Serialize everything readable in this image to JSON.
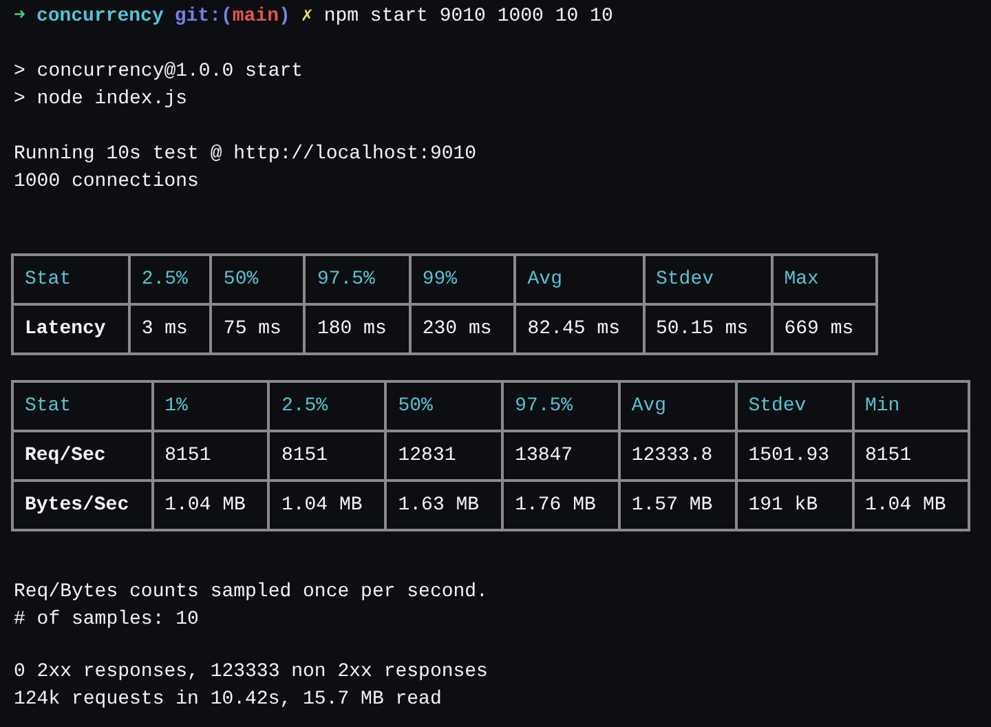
{
  "prompt": {
    "arrow": "➜",
    "directory": "concurrency",
    "git_prefix": "git:(",
    "branch": "main",
    "git_suffix": ")",
    "dirty_mark": "✗",
    "command": "npm start 9010 1000 10 10"
  },
  "blocks_before": [
    [
      "> concurrency@1.0.0 start",
      "> node index.js"
    ],
    [
      "Running 10s test @ http://localhost:9010",
      "1000 connections"
    ]
  ],
  "tables": [
    {
      "columns": [
        "Stat",
        "2.5%",
        "50%",
        "97.5%",
        "99%",
        "Avg",
        "Stdev",
        "Max"
      ],
      "rows": [
        {
          "cells": [
            "Latency",
            "3 ms",
            "75 ms",
            "180 ms",
            "230 ms",
            "82.45 ms",
            "50.15 ms",
            "669 ms"
          ]
        }
      ]
    },
    {
      "columns": [
        "Stat",
        "1%",
        "2.5%",
        "50%",
        "97.5%",
        "Avg",
        "Stdev",
        "Min"
      ],
      "rows": [
        {
          "cells": [
            "Req/Sec",
            "8151",
            "8151",
            "12831",
            "13847",
            "12333.8",
            "1501.93",
            "8151"
          ]
        },
        {
          "cells": [
            "Bytes/Sec",
            "1.04 MB",
            "1.04 MB",
            "1.63 MB",
            "1.76 MB",
            "1.57 MB",
            "191 kB",
            "1.04 MB"
          ]
        }
      ]
    }
  ],
  "blocks_after": [
    [
      "Req/Bytes counts sampled once per second.",
      "# of samples: 10"
    ],
    [
      "0 2xx responses, 123333 non 2xx responses",
      "124k requests in 10.42s, 15.7 MB read"
    ]
  ]
}
